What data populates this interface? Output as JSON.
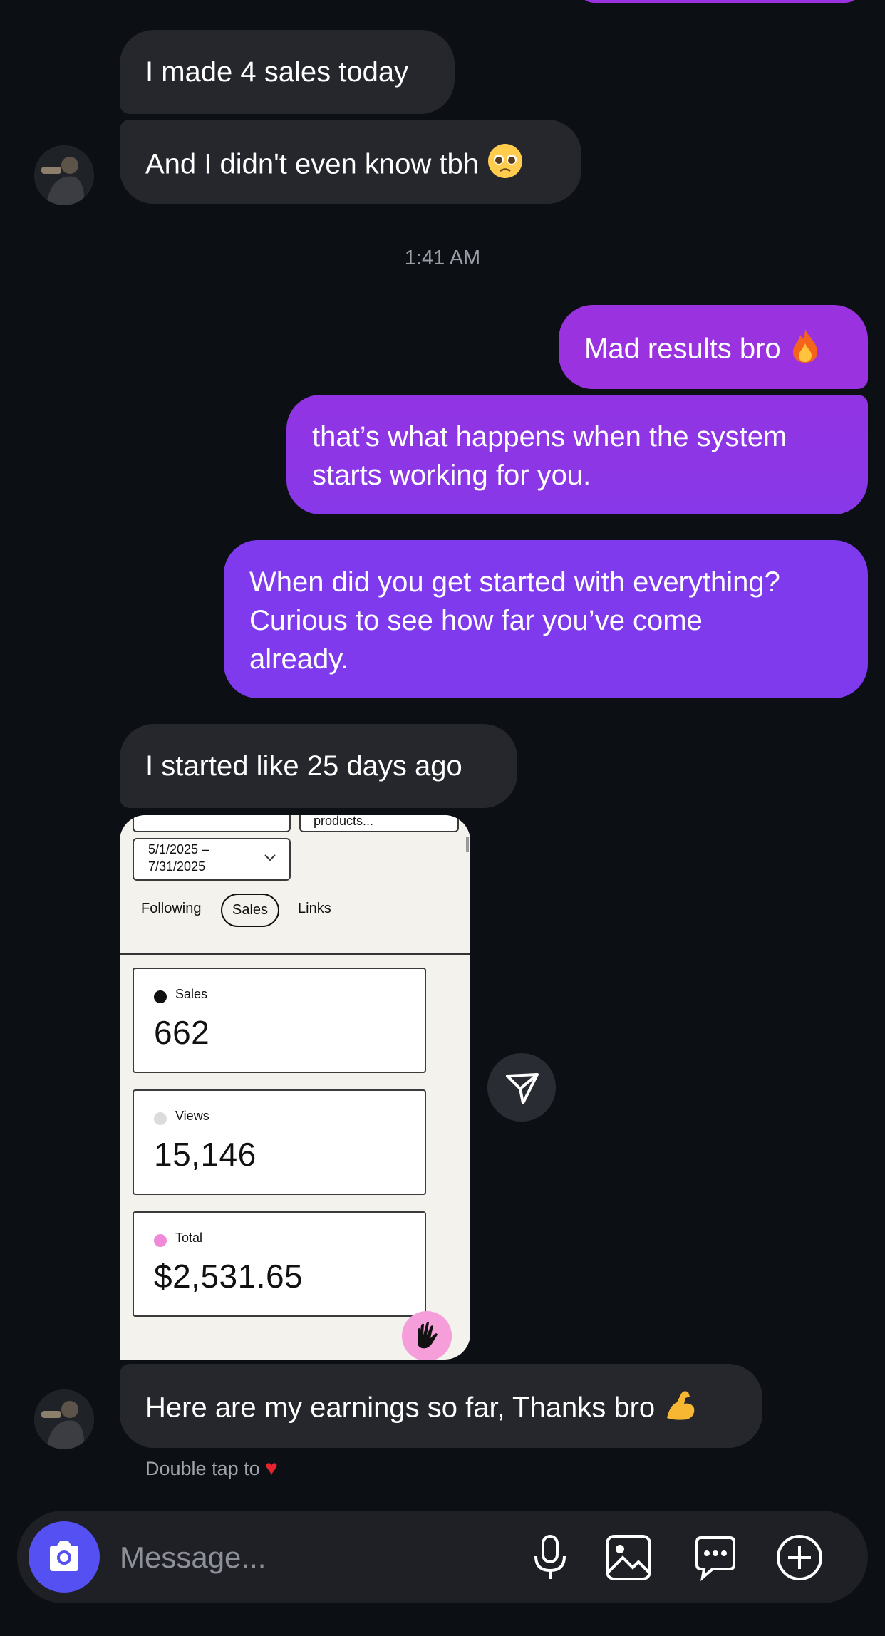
{
  "messages": {
    "m1": "I made 4 sales today",
    "m2": "And I didn't even know tbh",
    "timestamp": "1:41 AM",
    "m3": "Mad results bro",
    "m4_line1": "that’s what happens when the system",
    "m4_line2": "starts working for you.",
    "m5_line1": "When did you get started with everything?",
    "m5_line2": "Curious to see how far you’ve come",
    "m5_line3": "already.",
    "m6": "I started like 25 days ago",
    "m7": "Here are my earnings so far, Thanks bro"
  },
  "shared_screenshot": {
    "top_field_text": "products...",
    "date_range_line1": "5/1/2025 –",
    "date_range_line2": "7/31/2025",
    "tabs": [
      "Following",
      "Sales",
      "Links"
    ],
    "active_tab": "Sales",
    "metrics": [
      {
        "label": "Sales",
        "value": "662",
        "dot_color": "#111111"
      },
      {
        "label": "Views",
        "value": "15,146",
        "dot_color": "#dcdcdc"
      },
      {
        "label": "Total",
        "value": "$2,531.65",
        "dot_color": "#f08ad8"
      }
    ]
  },
  "hint": "Double tap to",
  "composer": {
    "placeholder": "Message...",
    "icons": [
      "camera-icon",
      "microphone-icon",
      "gallery-icon",
      "chat-bubble-icon",
      "plus-circle-icon"
    ]
  },
  "colors": {
    "background": "#0c0f14",
    "incoming_bubble": "#26272c",
    "outgoing_top": "#9a32df",
    "outgoing_bottom": "#7f3aee",
    "camera_button": "#5450f1"
  }
}
